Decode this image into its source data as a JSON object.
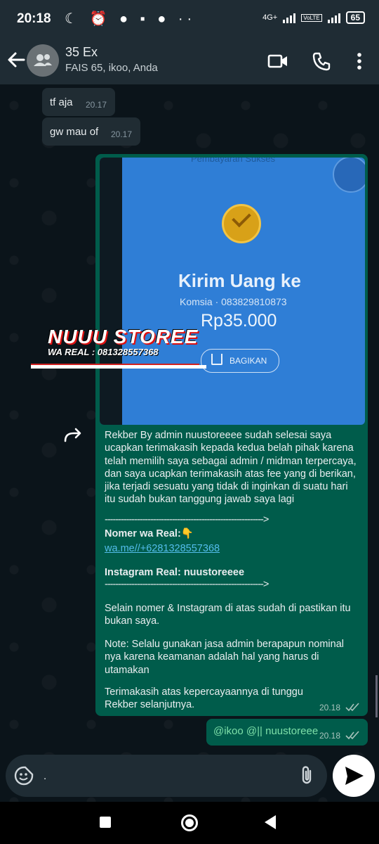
{
  "status_bar": {
    "time": "20:18",
    "network_label": "4G+",
    "volte_label": "VoLTE",
    "battery": "65"
  },
  "header": {
    "title": "35 Ex",
    "subtitle": "FAIS 65, ikoo, Anda"
  },
  "messages": [
    {
      "text": "tf aja",
      "time": "20.17"
    },
    {
      "text": "gw mau of",
      "time": "20.17"
    }
  ],
  "media_image": {
    "top_text": "Pembayaran Sukses",
    "heading": "Kirim Uang ke",
    "recipient": "Komsia · 083829810873",
    "amount": "Rp35.000",
    "share_button": "BAGIKAN",
    "watermark_brand": "NUUU STOREE",
    "watermark_sub": "WA REAL : 081328557368"
  },
  "outgoing_message": {
    "p1": "Rekber By admin nuustoreeee sudah selesai saya ucapkan terimakasih kepada kedua belah pihak karena telah memilih saya sebagai admin / midman terpercaya, dan saya ucapkan terimakasih atas fee yang di berikan, jika terjadi sesuatu yang tidak di inginkan di suatu hari itu sudah bukan tanggung jawab saya lagi",
    "divider1": "----------------------------------------------------------->",
    "nomer_label": "Nomer wa Real:👇",
    "wa_link": "wa.me//+6281328557368",
    "instagram_label": "Instagram Real: nuustoreeee",
    "divider2": "----------------------------------------------------------->",
    "p2": "Selain nomer & Instagram di atas sudah di pastikan itu bukan saya.",
    "p3": "Note: Selalu gunakan jasa admin berapapun nominal nya karena keamanan adalah hal yang harus di utamakan",
    "p4": "Terimakasih atas kepercayaannya di tunggu Rekber selanjutnya.",
    "time": "20.18"
  },
  "mention_message": {
    "text": "@ikoo @|| nuustoreee",
    "time": "20.18"
  },
  "input": {
    "value": "."
  },
  "colors": {
    "outgoing_bubble": "#005c4b",
    "incoming_bubble": "#202c33",
    "header": "#1f2c34",
    "link": "#53bdeb"
  },
  "icons": [
    "back-arrow-icon",
    "group-avatar-icon",
    "video-call-icon",
    "phone-icon",
    "more-vert-icon",
    "forward-icon",
    "sticker-icon",
    "attach-icon",
    "send-icon",
    "read-ticks-icon"
  ]
}
